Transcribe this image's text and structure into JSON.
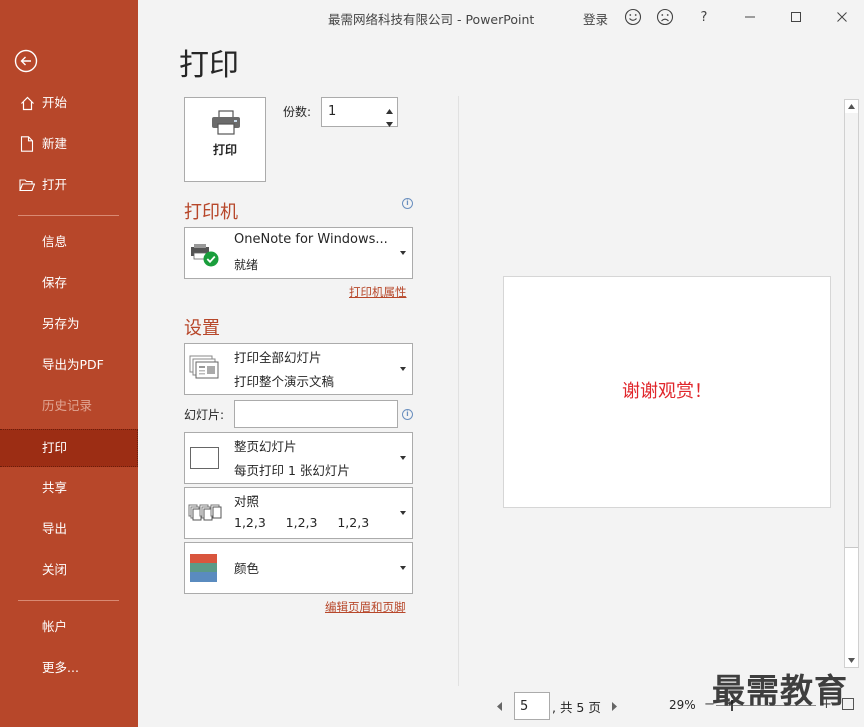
{
  "window": {
    "title": "最需网络科技有限公司  -  PowerPoint",
    "sign_in": "登录",
    "help": "?"
  },
  "sidebar": {
    "items": [
      {
        "label": "开始"
      },
      {
        "label": "新建"
      },
      {
        "label": "打开"
      },
      {
        "label": "信息"
      },
      {
        "label": "保存"
      },
      {
        "label": "另存为"
      },
      {
        "label": "导出为PDF"
      },
      {
        "label": "历史记录"
      },
      {
        "label": "打印"
      },
      {
        "label": "共享"
      },
      {
        "label": "导出"
      },
      {
        "label": "关闭"
      },
      {
        "label": "帐户"
      },
      {
        "label": "更多..."
      }
    ]
  },
  "print": {
    "heading": "打印",
    "print_button": "打印",
    "copies_label": "份数:",
    "copies_value": "1",
    "printer_section": "打印机",
    "printer_name": "OneNote for Windows...",
    "printer_status": "就绪",
    "printer_properties": "打印机属性",
    "settings_section": "设置",
    "range_line1": "打印全部幻灯片",
    "range_line2": "打印整个演示文稿",
    "slides_label": "幻灯片:",
    "slides_value": "",
    "layout_line1": "整页幻灯片",
    "layout_line2": "每页打印 1 张幻灯片",
    "collate_line1": "对照",
    "collate_line2": "1,2,3     1,2,3     1,2,3",
    "color_label": "颜色",
    "edit_header_footer": "编辑页眉和页脚"
  },
  "preview": {
    "slide_text": "谢谢观赏！",
    "slide_text_color": "#e0262b",
    "page_value": "5",
    "page_total": ", 共 5 页",
    "zoom": "29%"
  },
  "watermark": "最需教育",
  "colors": {
    "accent": "#b7472a",
    "accent_active": "#9c2d14"
  }
}
